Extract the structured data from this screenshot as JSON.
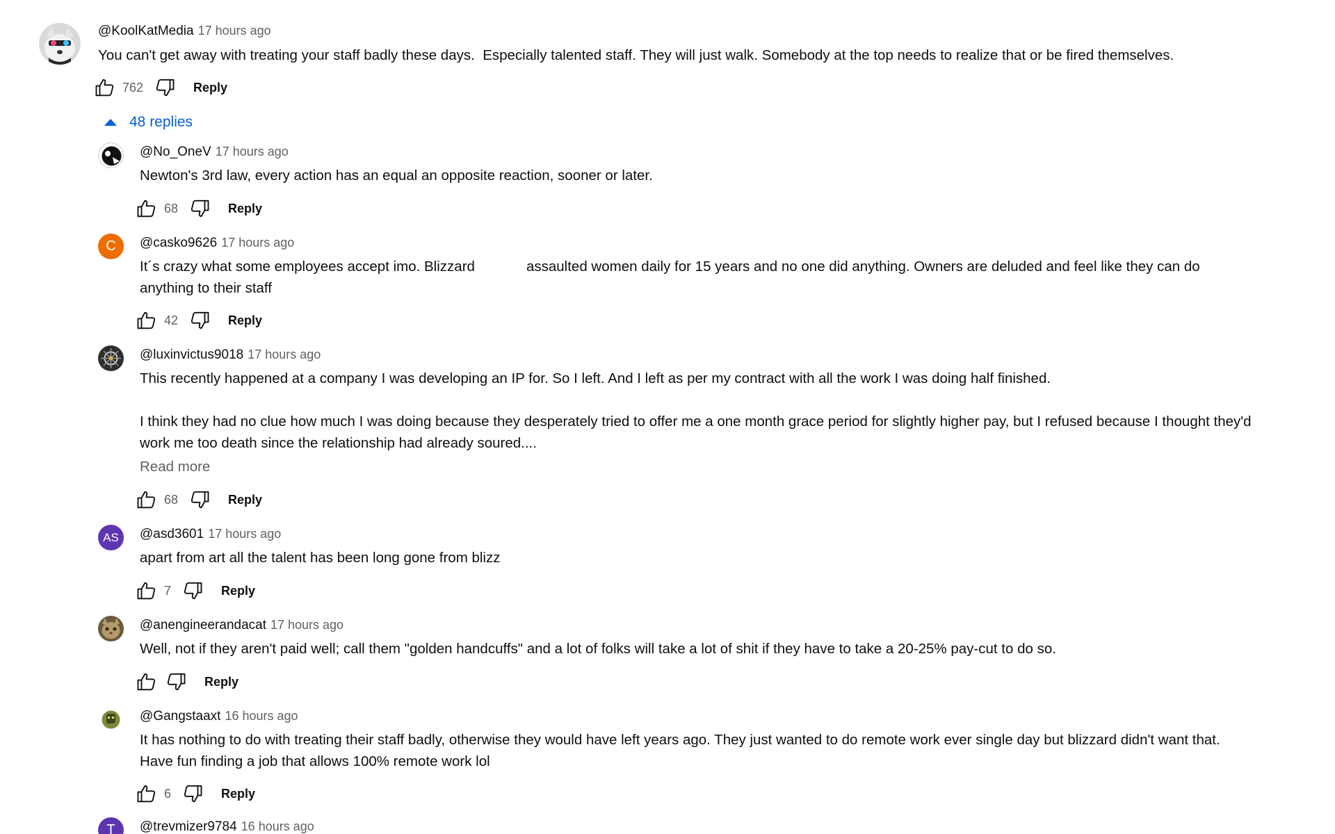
{
  "top_comment": {
    "author": "@KoolKatMedia",
    "time": "17 hours ago",
    "text": "You can't get away with treating your staff badly these days.  Especially talented staff. They will just walk. Somebody at the top needs to realize that or be fired themselves.",
    "likes": "762",
    "reply_label": "Reply",
    "replies_toggle": "48 replies"
  },
  "replies": [
    {
      "author": "@No_OneV",
      "time": "17 hours ago",
      "text": "Newton's 3rd law, every action has an equal an opposite reaction, sooner or later.",
      "likes": "68",
      "reply_label": "Reply",
      "avatar_color": "#1a1a1a"
    },
    {
      "author": "@casko9626",
      "time": "17 hours ago",
      "text": "It´s crazy what some employees accept imo. Blizzard             assaulted women daily for 15 years and no one did anything. Owners are deluded and feel like they can do\nanything to their staff",
      "likes": "42",
      "reply_label": "Reply",
      "avatar_letter": "C",
      "avatar_color": "#ef6c00"
    },
    {
      "author": "@luxinvictus9018",
      "time": "17 hours ago",
      "text": "This recently happened at a company I was developing an IP for. So I left. And I left as per my contract with all the work I was doing half finished.\n\nI think they had no clue how much I was doing because they desperately tried to offer me a one month grace period for slightly higher pay, but I refused because I thought they'd\nwork me too death since the relationship had already soured....",
      "read_more": "Read more",
      "likes": "68",
      "reply_label": "Reply",
      "avatar_color": "#3a3a3a"
    },
    {
      "author": "@asd3601",
      "time": "17 hours ago",
      "text": "apart from art all the talent has been long gone from blizz",
      "likes": "7",
      "reply_label": "Reply",
      "avatar_letter": "AS",
      "avatar_color": "#5e35b1"
    },
    {
      "author": "@anengineerandacat",
      "time": "17 hours ago",
      "text": "Well, not if they aren't paid well; call them \"golden handcuffs\" and a lot of folks will take a lot of shit if they have to take a 20-25% pay-cut to do so.",
      "likes": "",
      "reply_label": "Reply",
      "avatar_color": "#8d7a5a"
    },
    {
      "author": "@Gangstaaxt",
      "time": "16 hours ago",
      "text": "It has nothing to do with treating their staff badly, otherwise they would have left years ago. They just wanted to do remote work ever single day but blizzard didn't want that.\nHave fun finding a job that allows 100% remote work lol",
      "likes": "6",
      "reply_label": "Reply",
      "avatar_color": "#6d7a3a"
    },
    {
      "author": "@trevmizer9784",
      "time": "16 hours ago",
      "avatar_letter": "T",
      "avatar_color": "#5e35b1"
    }
  ]
}
